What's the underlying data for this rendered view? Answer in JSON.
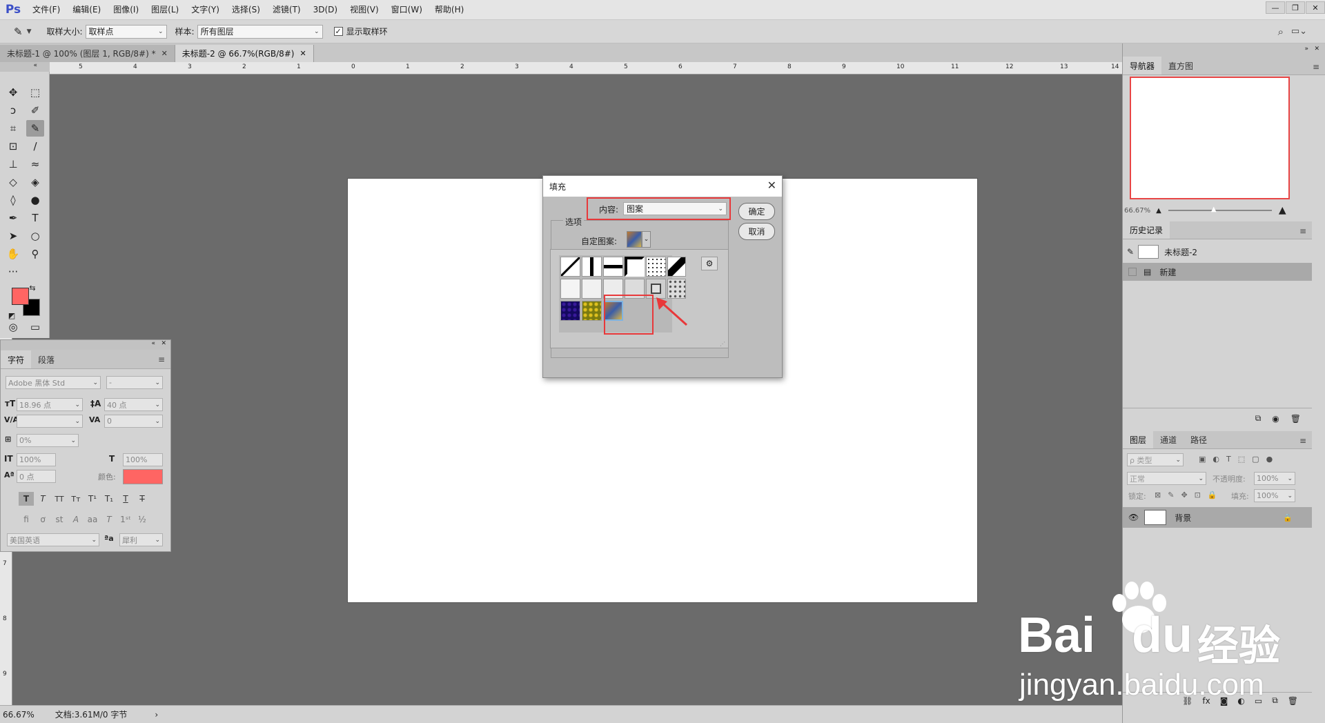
{
  "app": {
    "logo": "Ps"
  },
  "menu": [
    "文件(F)",
    "编辑(E)",
    "图像(I)",
    "图层(L)",
    "文字(Y)",
    "选择(S)",
    "滤镜(T)",
    "3D(D)",
    "视图(V)",
    "窗口(W)",
    "帮助(H)"
  ],
  "options": {
    "sample_size_label": "取样大小:",
    "sample_size_value": "取样点",
    "sample_label": "样本:",
    "sample_value": "所有图层",
    "show_ring_label": "显示取样环",
    "show_ring_checked": true
  },
  "tabs": [
    {
      "label": "未标题-1 @ 100% (图层 1, RGB/8#) *",
      "active": false
    },
    {
      "label": "未标题-2 @ 66.7%(RGB/8#)",
      "active": true
    }
  ],
  "ruler_h": [
    "5",
    "4",
    "3",
    "2",
    "1",
    "0",
    "1",
    "2",
    "3",
    "4",
    "5",
    "6",
    "7",
    "8",
    "9",
    "10",
    "11",
    "12",
    "13",
    "14"
  ],
  "ruler_v": [
    "7",
    "8",
    "9"
  ],
  "colors": {
    "foreground": "#ff6563",
    "background": "#000000",
    "highlight": "#e8383a"
  },
  "character_panel": {
    "tabs": [
      "字符",
      "段落"
    ],
    "font_family": "Adobe 黑体 Std",
    "font_style": "-",
    "font_size": "18.96 点",
    "leading": "40 点",
    "kerning": "",
    "tracking": "0",
    "scale_percent": "0%",
    "vertical_scale": "100%",
    "horizontal_scale": "100%",
    "baseline": "0 点",
    "color_label": "颜色:",
    "color": "#ff6563",
    "language": "美国英语",
    "aa_label": "a",
    "antialias": "犀利"
  },
  "dialog": {
    "title": "填充",
    "content_label": "内容:",
    "content_value": "图案",
    "ok": "确定",
    "cancel": "取消",
    "options_label": "选项",
    "custom_pattern_label": "自定图案:"
  },
  "navigator": {
    "tabs": [
      "导航器",
      "直方图"
    ],
    "zoom": "66.67%"
  },
  "history": {
    "tab": "历史记录",
    "items": [
      "未标题-2",
      "新建"
    ]
  },
  "layers": {
    "tabs": [
      "图层",
      "通道",
      "路径"
    ],
    "filter_placeholder": "ρ 类型",
    "blend_mode": "正常",
    "opacity_label": "不透明度:",
    "opacity": "100%",
    "lock_label": "锁定:",
    "fill_label": "填充:",
    "fill": "100%",
    "layer_name": "背景"
  },
  "status": {
    "zoom": "66.67%",
    "doc": "文档:3.61M/0 字节"
  },
  "watermark": {
    "brand": "Bai",
    "brand2": "du",
    "cn": "经验",
    "url": "jingyan.baidu.com"
  }
}
